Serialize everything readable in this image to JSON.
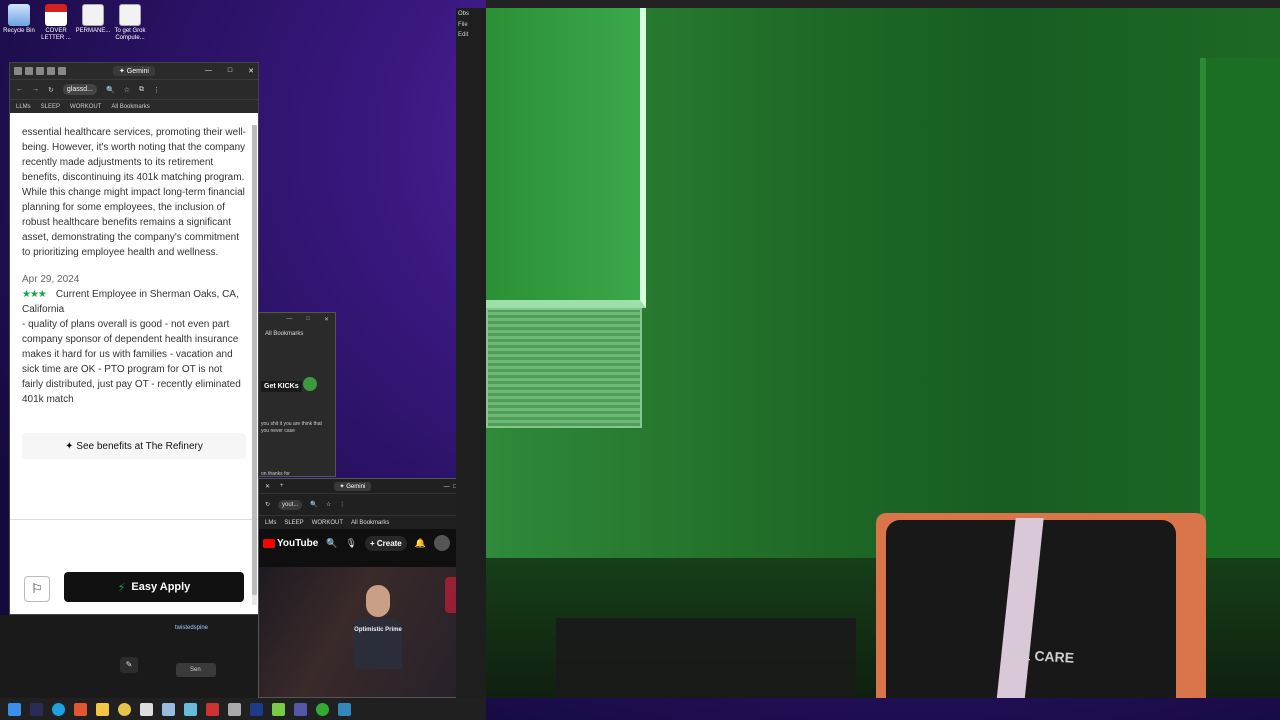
{
  "desktop": {
    "icons": [
      {
        "label": "Recycle Bin",
        "icon": "recycle-bin-icon"
      },
      {
        "label": "COVER LETTER ...",
        "icon": "pdf-icon"
      },
      {
        "label": "PERMANE...",
        "icon": "document-icon"
      },
      {
        "label": "To get Grok Compute...",
        "icon": "document-icon"
      }
    ]
  },
  "browser_left": {
    "gemini_tab": "✦ Gemini",
    "url": "glassd...",
    "bookmarks": [
      "LLMs",
      "SLEEP",
      "WORKOUT",
      "All Bookmarks"
    ],
    "review1_text": "essential healthcare services, promoting their well-being. However, it's worth noting that the company recently made adjustments to its retirement benefits, discontinuing its 401k matching program. While this change might impact long-term financial planning for some employees, the inclusion of robust healthcare benefits remains a significant asset, demonstrating the company's commitment to prioritizing employee health and wellness.",
    "review2_date": "Apr 29, 2024",
    "review2_stars": "★★★",
    "review2_author": "Current Employee in Sherman Oaks, CA, California",
    "review2_text": "- quality of plans overall is good - not even part company sponsor of dependent health insurance makes it hard for us with families - vacation and sick time are OK - PTO program for OT is not fairly distributed, just pay OT - recently eliminated 401k match",
    "benefits_button": "See benefits at The Refinery",
    "apply_button": "Easy Apply"
  },
  "mid_window": {
    "bookmarks": "All Bookmarks",
    "kicks_label": "Get KICKs",
    "chat_text": "you shit it you are think that you never case",
    "chat_text2": "on thanks for"
  },
  "youtube": {
    "gemini_tab": "✦ Gemini",
    "url": "yout...",
    "bookmarks": [
      "LMs",
      "SLEEP",
      "WORKOUT",
      "All Bookmarks"
    ],
    "logo_text": "YouTube",
    "create_button": "+ Create",
    "shirt_text": "Optimistic Prime"
  },
  "chat_panel": {
    "user": "twistedspine",
    "send_label": "Sen"
  },
  "obs": {
    "title": "Obs",
    "menu": [
      "File",
      "Edit"
    ]
  },
  "camera": {
    "logo_text": "T & CARE"
  }
}
